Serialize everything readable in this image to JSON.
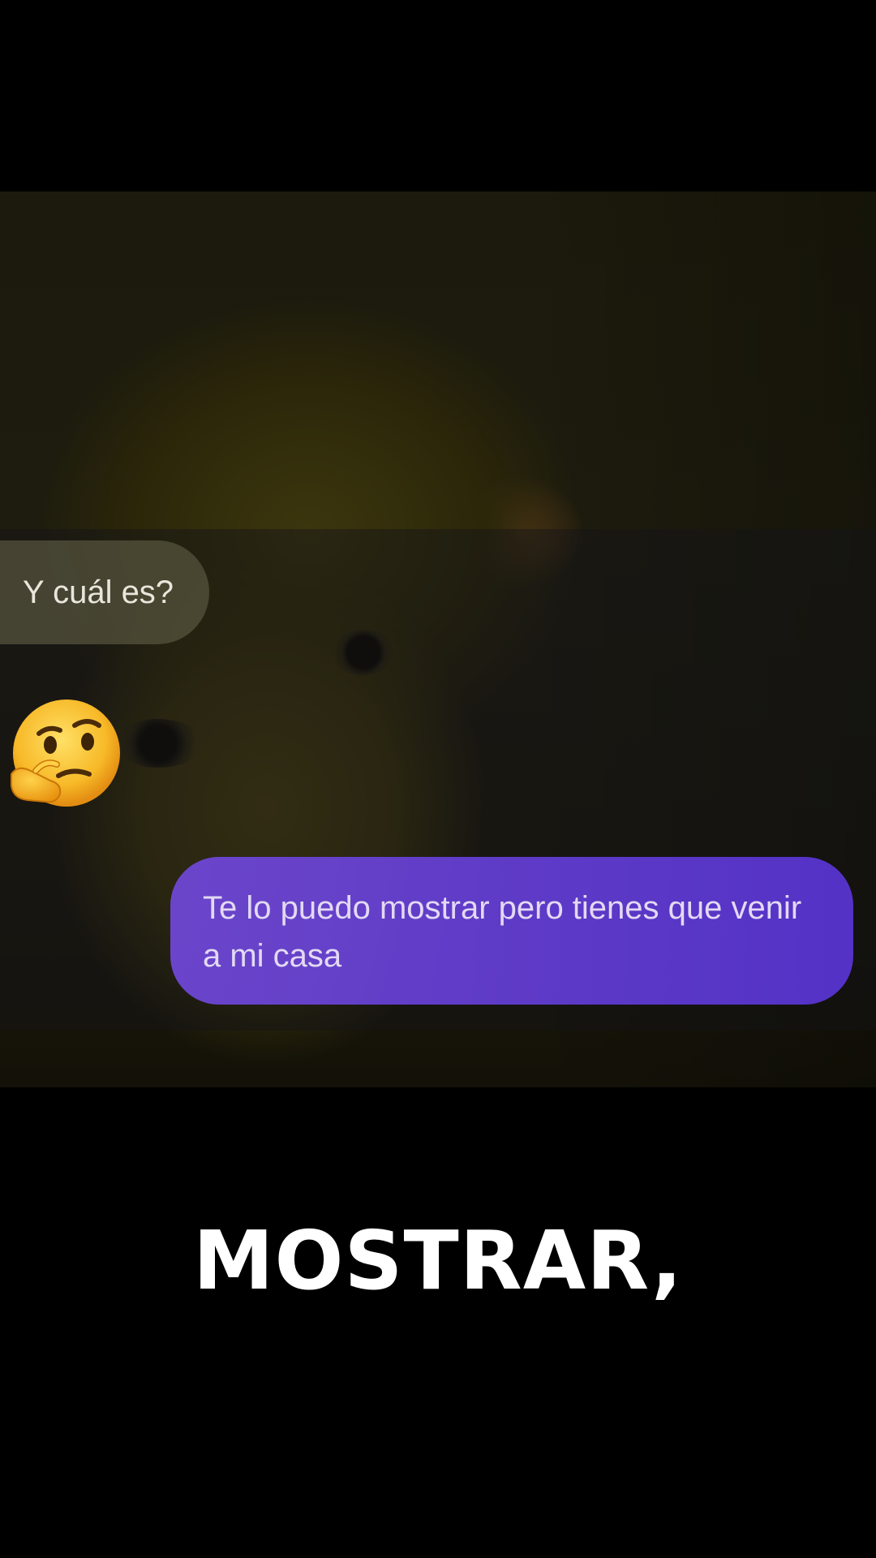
{
  "chat": {
    "received_message": "Y cuál es?",
    "reaction_emoji": "thinking-face-icon",
    "sent_message": "Te lo puedo mostrar pero tienes que venir a mi casa"
  },
  "caption": {
    "text": "MOSTRAR,"
  },
  "colors": {
    "background": "#000000",
    "sent_bubble": "#6a44d8",
    "received_bubble": "#58543e",
    "caption_text": "#ffffff"
  }
}
